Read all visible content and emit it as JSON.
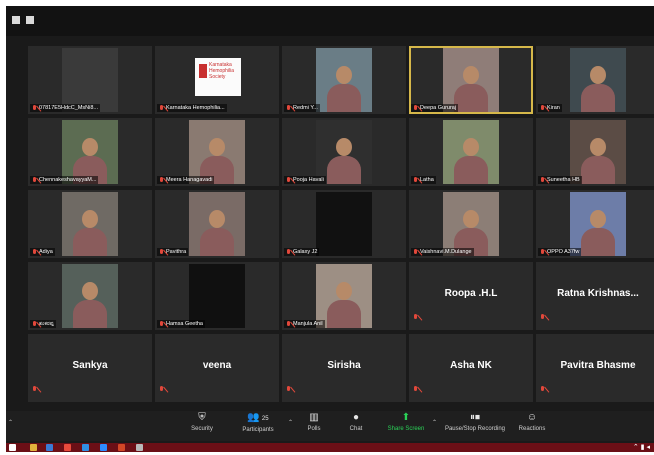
{
  "meeting": {
    "tiles": [
      {
        "kind": "video",
        "name": "07817E5HdcC_MsNi8...",
        "bg": "#3a3a3a",
        "person": false
      },
      {
        "kind": "logo",
        "name": "Karnataka Hemophilia...",
        "logo_text": "Karnataka Hemophilia Society"
      },
      {
        "kind": "video",
        "name": "Redmi Y...",
        "bg": "#6a7d86",
        "person": true
      },
      {
        "kind": "video",
        "name": "Deepa Gururaj",
        "bg": "#8f7d78",
        "person": true,
        "active": true
      },
      {
        "kind": "video",
        "name": "Kiran",
        "bg": "#3f4a4f",
        "person": true
      },
      {
        "kind": "video",
        "name": "ChennakeshavayyaM...",
        "bg": "#5c6c52",
        "person": true
      },
      {
        "kind": "video",
        "name": "Meera Hanagavadi",
        "bg": "#8a7a71",
        "person": true
      },
      {
        "kind": "video",
        "name": "Pooja Havali",
        "bg": "#2f2f2f",
        "person": true
      },
      {
        "kind": "video",
        "name": "Latha",
        "bg": "#7f8b6b",
        "person": true
      },
      {
        "kind": "video",
        "name": "Suneetha HB",
        "bg": "#5b4c45",
        "person": true
      },
      {
        "kind": "video",
        "name": "Adiya",
        "bg": "#6f6a64",
        "person": true
      },
      {
        "kind": "video",
        "name": "Pavithra",
        "bg": "#7a6b66",
        "person": true
      },
      {
        "kind": "video",
        "name": "Galaxy J2",
        "bg": "#111111",
        "person": false
      },
      {
        "kind": "video",
        "name": "Vaishnavi.M.Dulange",
        "bg": "#8c7e76",
        "person": true
      },
      {
        "kind": "video",
        "name": "OPPO A37fw",
        "bg": "#6d7da8",
        "person": true
      },
      {
        "kind": "video",
        "name": "ಶಂಕರಪ್ಪ",
        "bg": "#55605a",
        "person": true
      },
      {
        "kind": "video",
        "name": "Hamsa Geetha",
        "bg": "#101010",
        "person": false
      },
      {
        "kind": "video",
        "name": "Manjula Anil",
        "bg": "#9d8f84",
        "person": true
      },
      {
        "kind": "name",
        "name": "Roopa .H.L"
      },
      {
        "kind": "name",
        "name": "Ratna  Krishnas..."
      },
      {
        "kind": "name",
        "name": "Sankya"
      },
      {
        "kind": "name",
        "name": "veena"
      },
      {
        "kind": "name",
        "name": "Sirisha"
      },
      {
        "kind": "name",
        "name": "Asha NK"
      },
      {
        "kind": "name",
        "name": "Pavitra Bhasme"
      }
    ]
  },
  "toolbar": {
    "security": "Security",
    "participants": "Participants",
    "participants_count": "25",
    "polls": "Polls",
    "chat": "Chat",
    "share_screen": "Share Screen",
    "pause_stop_recording": "Pause/Stop Recording",
    "reactions": "Reactions"
  },
  "taskbar": {
    "icons": [
      {
        "name": "start-icon",
        "color": "#ffffff"
      },
      {
        "name": "file-explorer-icon",
        "color": "#e3b23c"
      },
      {
        "name": "store-icon",
        "color": "#3a7bd5"
      },
      {
        "name": "chrome-icon",
        "color": "#e94b3c"
      },
      {
        "name": "edge-icon",
        "color": "#2f8fe3"
      },
      {
        "name": "zoom-icon",
        "color": "#2d8cff"
      },
      {
        "name": "powerpoint-icon",
        "color": "#d24726"
      },
      {
        "name": "app-icon",
        "color": "#b9b9b9"
      }
    ]
  }
}
